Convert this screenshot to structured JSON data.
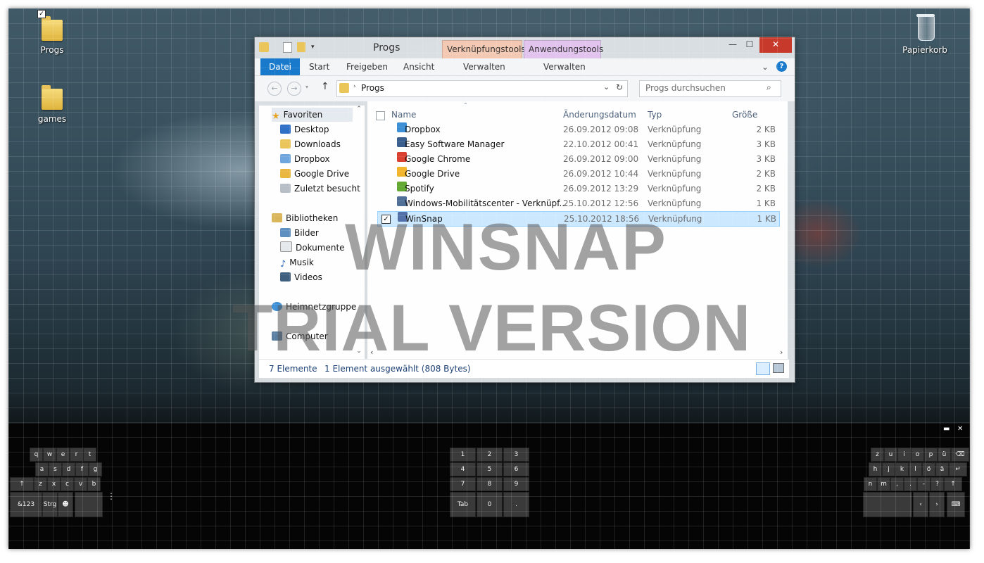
{
  "desktop": {
    "icons": [
      {
        "label": "Progs",
        "icon": "folder-checked-icon"
      },
      {
        "label": "games",
        "icon": "folder-icon"
      },
      {
        "label": "Papierkorb",
        "icon": "recycle-bin-icon"
      }
    ]
  },
  "window": {
    "title": "Progs",
    "context_tabs": [
      "Verknüpfungstools",
      "Anwendungstools"
    ],
    "ribbon_tabs": [
      "Datei",
      "Start",
      "Freigeben",
      "Ansicht",
      "Verwalten",
      "Verwalten"
    ],
    "address": {
      "path": "Progs"
    },
    "search": {
      "placeholder": "Progs durchsuchen"
    },
    "nav": {
      "favorites": {
        "label": "Favoriten",
        "items": [
          "Desktop",
          "Downloads",
          "Dropbox",
          "Google Drive",
          "Zuletzt besucht"
        ]
      },
      "libraries": {
        "label": "Bibliotheken",
        "items": [
          "Bilder",
          "Dokumente",
          "Musik",
          "Videos"
        ]
      },
      "homegroup": "Heimnetzgruppe",
      "computer": "Computer"
    },
    "columns": [
      "Name",
      "Änderungsdatum",
      "Typ",
      "Größe"
    ],
    "files": [
      {
        "name": "Dropbox",
        "date": "26.09.2012 09:08",
        "type": "Verknüpfung",
        "size": "2 KB",
        "color": "#3d8fd6",
        "selected": false
      },
      {
        "name": "Easy Software Manager",
        "date": "22.10.2012 00:41",
        "type": "Verknüpfung",
        "size": "3 KB",
        "color": "#3a5f8e",
        "selected": false
      },
      {
        "name": "Google Chrome",
        "date": "26.09.2012 09:00",
        "type": "Verknüpfung",
        "size": "3 KB",
        "color": "#d9402f",
        "selected": false
      },
      {
        "name": "Google Drive",
        "date": "26.09.2012 10:44",
        "type": "Verknüpfung",
        "size": "2 KB",
        "color": "#f2b42b",
        "selected": false
      },
      {
        "name": "Spotify",
        "date": "26.09.2012 13:29",
        "type": "Verknüpfung",
        "size": "2 KB",
        "color": "#63a832",
        "selected": false
      },
      {
        "name": "Windows-Mobilitätscenter - Verknüpf...",
        "date": "25.10.2012 12:56",
        "type": "Verknüpfung",
        "size": "1 KB",
        "color": "#4f6f97",
        "selected": false
      },
      {
        "name": "WinSnap",
        "date": "25.10.2012 18:56",
        "type": "Verknüpfung",
        "size": "1 KB",
        "color": "#5470a8",
        "selected": true
      }
    ],
    "status": {
      "count": "7 Elemente",
      "selection": "1 Element ausgewählt (808 Bytes)"
    }
  },
  "watermark": {
    "line1": "WINSNAP",
    "line2": "TRIAL VERSION"
  },
  "keyboard": {
    "left_rows": [
      [
        "q",
        "w",
        "e",
        "r",
        "t"
      ],
      [
        "a",
        "s",
        "d",
        "f",
        "g"
      ],
      [
        "↑",
        "z",
        "x",
        "c",
        "v",
        "b"
      ]
    ],
    "left_bottom": [
      "&123",
      "Strg",
      "☻",
      ""
    ],
    "numpad": [
      [
        "1",
        "2",
        "3"
      ],
      [
        "4",
        "5",
        "6"
      ],
      [
        "7",
        "8",
        "9"
      ],
      [
        "Tab",
        "0",
        "."
      ]
    ],
    "right_rows": [
      [
        "z",
        "u",
        "i",
        "o",
        "p",
        "ü",
        "⌫"
      ],
      [
        "h",
        "j",
        "k",
        "l",
        "ö",
        "ä",
        "↵"
      ],
      [
        "n",
        "m",
        ",",
        ".",
        "-",
        "?",
        "↑"
      ]
    ],
    "right_bottom": [
      "",
      "‹",
      "›",
      "⌨"
    ],
    "controls": [
      "▬",
      "✕"
    ]
  }
}
